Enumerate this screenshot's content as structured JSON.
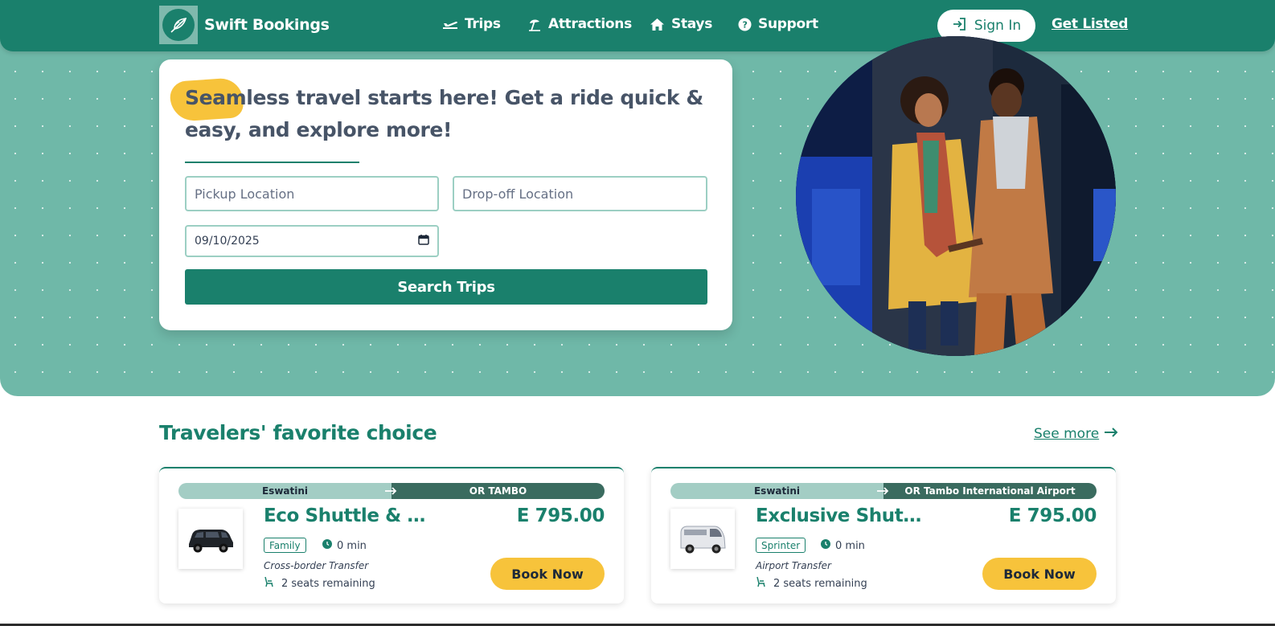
{
  "brand": {
    "name": "Swift Bookings",
    "logo_icon": "feather-wing-icon"
  },
  "nav": {
    "items": [
      {
        "label": "Trips",
        "icon": "plane-icon"
      },
      {
        "label": "Attractions",
        "icon": "beach-umbrella-icon"
      },
      {
        "label": "Stays",
        "icon": "home-icon"
      },
      {
        "label": "Support",
        "icon": "question-circle-icon"
      }
    ],
    "sign_in_label": "Sign In",
    "get_listed_label": "Get Listed"
  },
  "search": {
    "headline": "Seamless travel starts here! Get a ride quick & easy, and explore more!",
    "pickup_placeholder": "Pickup Location",
    "dropoff_placeholder": "Drop-off Location",
    "date_value": "09/10/2025",
    "button_label": "Search Trips"
  },
  "favorites": {
    "title": "Travelers' favorite choice",
    "see_more_label": "See more",
    "cards": [
      {
        "from": "Eswatini",
        "to": "OR TAMBO",
        "name": "Eco Shuttle & C...",
        "price": "E 795.00",
        "vehicle_class": "Family",
        "duration": "0 min",
        "transfer_type": "Cross-border Transfer",
        "seats": "2 seats remaining",
        "book_label": "Book Now"
      },
      {
        "from": "Eswatini",
        "to": "OR Tambo International Airport",
        "name": "Exclusive Shutt...",
        "price": "E 795.00",
        "vehicle_class": "Sprinter",
        "duration": "0 min",
        "transfer_type": "Airport Transfer",
        "seats": "2 seats remaining",
        "book_label": "Book Now"
      }
    ]
  },
  "colors": {
    "primary": "#1a806c",
    "hero_bg": "#6fb8a8",
    "accent": "#f7c33b"
  }
}
